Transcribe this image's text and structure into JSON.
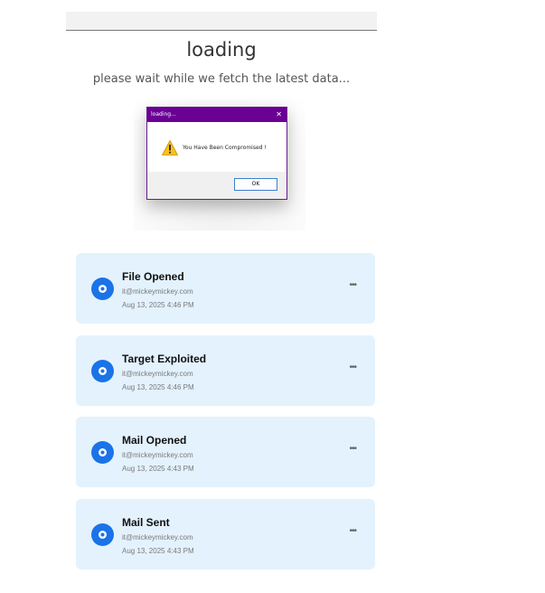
{
  "header": {
    "title": "loading",
    "subtitle": "please wait while we fetch the latest data..."
  },
  "dialog": {
    "title": "loading...",
    "close_glyph": "✕",
    "message": "You Have Been Compromised !",
    "ok_label": "OK",
    "icon": "warning-icon"
  },
  "activity": {
    "items": [
      {
        "title": "File Opened",
        "email": "it@mickeymickey.com",
        "date": "Aug 13, 2025 4:46 PM",
        "menu": "•••"
      },
      {
        "title": "Target Exploited",
        "email": "it@mickeymickey.com",
        "date": "Aug 13, 2025 4:46 PM",
        "menu": "•••"
      },
      {
        "title": "Mail Opened",
        "email": "it@mickeymickey.com",
        "date": "Aug 13, 2025 4:43 PM",
        "menu": "•••"
      },
      {
        "title": "Mail Sent",
        "email": "it@mickeymickey.com",
        "date": "Aug 13, 2025 4:43 PM",
        "menu": "•••"
      }
    ]
  },
  "colors": {
    "dialog_title_bar": "#6a0094",
    "card_background": "#e3f2fd",
    "card_icon": "#1a73e8"
  }
}
